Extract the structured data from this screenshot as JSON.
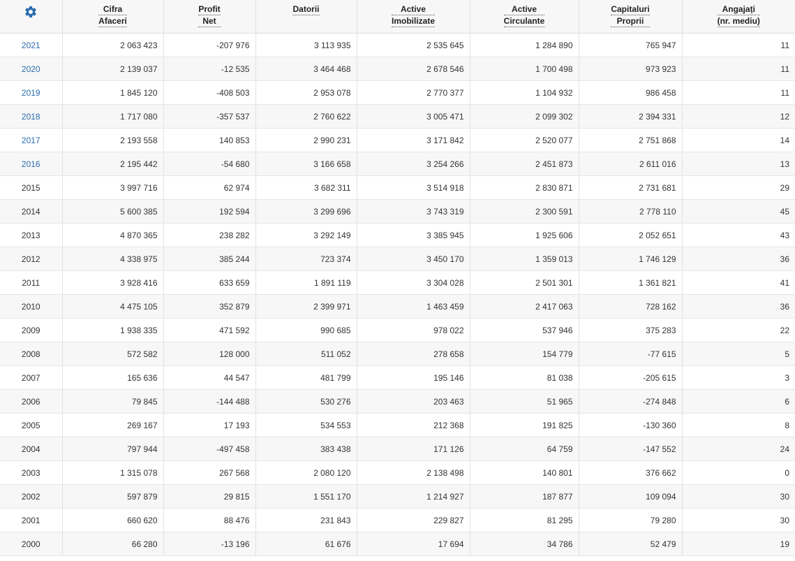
{
  "accent_color": "#2a6cb0",
  "settings_icon": "gear-icon",
  "columns": [
    {
      "l1": "Cifra",
      "l2": "Afaceri"
    },
    {
      "l1": "Profit",
      "l2": "Net"
    },
    {
      "l1": "Datorii",
      "l2": ""
    },
    {
      "l1": "Active",
      "l2": "Imobilizate"
    },
    {
      "l1": "Active",
      "l2": "Circulante"
    },
    {
      "l1": "Capitaluri",
      "l2": "Proprii"
    },
    {
      "l1": "Angajați",
      "l2": "(nr. mediu)"
    }
  ],
  "rows": [
    {
      "year": "2021",
      "link": true,
      "values": [
        "2 063 423",
        "-207 976",
        "3 113 935",
        "2 535 645",
        "1 284 890",
        "765 947",
        "11"
      ]
    },
    {
      "year": "2020",
      "link": true,
      "values": [
        "2 139 037",
        "-12 535",
        "3 464 468",
        "2 678 546",
        "1 700 498",
        "973 923",
        "11"
      ]
    },
    {
      "year": "2019",
      "link": true,
      "values": [
        "1 845 120",
        "-408 503",
        "2 953 078",
        "2 770 377",
        "1 104 932",
        "986 458",
        "11"
      ]
    },
    {
      "year": "2018",
      "link": true,
      "values": [
        "1 717 080",
        "-357 537",
        "2 760 622",
        "3 005 471",
        "2 099 302",
        "2 394 331",
        "12"
      ]
    },
    {
      "year": "2017",
      "link": true,
      "values": [
        "2 193 558",
        "140 853",
        "2 990 231",
        "3 171 842",
        "2 520 077",
        "2 751 868",
        "14"
      ]
    },
    {
      "year": "2016",
      "link": true,
      "values": [
        "2 195 442",
        "-54 680",
        "3 166 658",
        "3 254 266",
        "2 451 873",
        "2 611 016",
        "13"
      ]
    },
    {
      "year": "2015",
      "link": false,
      "values": [
        "3 997 716",
        "62 974",
        "3 682 311",
        "3 514 918",
        "2 830 871",
        "2 731 681",
        "29"
      ]
    },
    {
      "year": "2014",
      "link": false,
      "values": [
        "5 600 385",
        "192 594",
        "3 299 696",
        "3 743 319",
        "2 300 591",
        "2 778 110",
        "45"
      ]
    },
    {
      "year": "2013",
      "link": false,
      "values": [
        "4 870 365",
        "238 282",
        "3 292 149",
        "3 385 945",
        "1 925 606",
        "2 052 651",
        "43"
      ]
    },
    {
      "year": "2012",
      "link": false,
      "values": [
        "4 338 975",
        "385 244",
        "723 374",
        "3 450 170",
        "1 359 013",
        "1 746 129",
        "36"
      ]
    },
    {
      "year": "2011",
      "link": false,
      "values": [
        "3 928 416",
        "633 659",
        "1 891 119",
        "3 304 028",
        "2 501 301",
        "1 361 821",
        "41"
      ]
    },
    {
      "year": "2010",
      "link": false,
      "values": [
        "4 475 105",
        "352 879",
        "2 399 971",
        "1 463 459",
        "2 417 063",
        "728 162",
        "36"
      ]
    },
    {
      "year": "2009",
      "link": false,
      "values": [
        "1 938 335",
        "471 592",
        "990 685",
        "978 022",
        "537 946",
        "375 283",
        "22"
      ]
    },
    {
      "year": "2008",
      "link": false,
      "values": [
        "572 582",
        "128 000",
        "511 052",
        "278 658",
        "154 779",
        "-77 615",
        "5"
      ]
    },
    {
      "year": "2007",
      "link": false,
      "values": [
        "165 636",
        "44 547",
        "481 799",
        "195 146",
        "81 038",
        "-205 615",
        "3"
      ]
    },
    {
      "year": "2006",
      "link": false,
      "values": [
        "79 845",
        "-144 488",
        "530 276",
        "203 463",
        "51 965",
        "-274 848",
        "6"
      ]
    },
    {
      "year": "2005",
      "link": false,
      "values": [
        "269 167",
        "17 193",
        "534 553",
        "212 368",
        "191 825",
        "-130 360",
        "8"
      ]
    },
    {
      "year": "2004",
      "link": false,
      "values": [
        "797 944",
        "-497 458",
        "383 438",
        "171 126",
        "64 759",
        "-147 552",
        "24"
      ]
    },
    {
      "year": "2003",
      "link": false,
      "values": [
        "1 315 078",
        "267 568",
        "2 080 120",
        "2 138 498",
        "140 801",
        "376 662",
        "0"
      ]
    },
    {
      "year": "2002",
      "link": false,
      "values": [
        "597 879",
        "29 815",
        "1 551 170",
        "1 214 927",
        "187 877",
        "109 094",
        "30"
      ]
    },
    {
      "year": "2001",
      "link": false,
      "values": [
        "660 620",
        "88 476",
        "231 843",
        "229 827",
        "81 295",
        "79 280",
        "30"
      ]
    },
    {
      "year": "2000",
      "link": false,
      "values": [
        "66 280",
        "-13 196",
        "61 676",
        "17 694",
        "34 786",
        "52 479",
        "19"
      ]
    }
  ]
}
